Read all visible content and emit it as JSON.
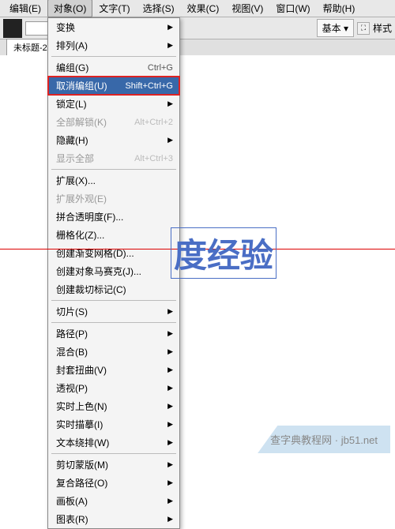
{
  "menubar": {
    "items": [
      "编辑(E)",
      "对象(O)",
      "文字(T)",
      "选择(S)",
      "效果(C)",
      "视图(V)",
      "窗口(W)",
      "帮助(H)"
    ],
    "active_index": 1
  },
  "toolbar": {
    "style_label": "基本",
    "style_suffix": "▾",
    "expand_glyph": "⛶",
    "extra_label": "样式"
  },
  "tabs": {
    "active": "未标题-2"
  },
  "menu": {
    "groups": [
      [
        {
          "label": "变换",
          "shortcut": "",
          "sub": true
        },
        {
          "label": "排列(A)",
          "shortcut": "",
          "sub": true
        }
      ],
      [
        {
          "label": "编组(G)",
          "shortcut": "Ctrl+G"
        },
        {
          "label": "取消编组(U)",
          "shortcut": "Shift+Ctrl+G",
          "highlight": true
        },
        {
          "label": "锁定(L)",
          "shortcut": "",
          "sub": true
        },
        {
          "label": "全部解锁(K)",
          "shortcut": "Alt+Ctrl+2",
          "disabled": true
        },
        {
          "label": "隐藏(H)",
          "shortcut": "",
          "sub": true
        },
        {
          "label": "显示全部",
          "shortcut": "Alt+Ctrl+3",
          "disabled": true
        }
      ],
      [
        {
          "label": "扩展(X)...",
          "shortcut": ""
        },
        {
          "label": "扩展外观(E)",
          "shortcut": "",
          "disabled": true
        },
        {
          "label": "拼合透明度(F)...",
          "shortcut": ""
        },
        {
          "label": "栅格化(Z)...",
          "shortcut": ""
        },
        {
          "label": "创建渐变网格(D)...",
          "shortcut": ""
        },
        {
          "label": "创建对象马赛克(J)...",
          "shortcut": ""
        },
        {
          "label": "创建裁切标记(C)",
          "shortcut": ""
        }
      ],
      [
        {
          "label": "切片(S)",
          "shortcut": "",
          "sub": true
        }
      ],
      [
        {
          "label": "路径(P)",
          "shortcut": "",
          "sub": true
        },
        {
          "label": "混合(B)",
          "shortcut": "",
          "sub": true
        },
        {
          "label": "封套扭曲(V)",
          "shortcut": "",
          "sub": true
        },
        {
          "label": "透视(P)",
          "shortcut": "",
          "sub": true
        },
        {
          "label": "实时上色(N)",
          "shortcut": "",
          "sub": true
        },
        {
          "label": "实时描摹(I)",
          "shortcut": "",
          "sub": true
        },
        {
          "label": "文本绕排(W)",
          "shortcut": "",
          "sub": true
        }
      ],
      [
        {
          "label": "剪切蒙版(M)",
          "shortcut": "",
          "sub": true
        },
        {
          "label": "复合路径(O)",
          "shortcut": "",
          "sub": true
        },
        {
          "label": "画板(A)",
          "shortcut": "",
          "sub": true
        },
        {
          "label": "图表(R)",
          "shortcut": "",
          "sub": true
        }
      ]
    ]
  },
  "canvas": {
    "text": "度经验"
  },
  "watermark": {
    "text": "查字典教程网 · jb51.net"
  }
}
